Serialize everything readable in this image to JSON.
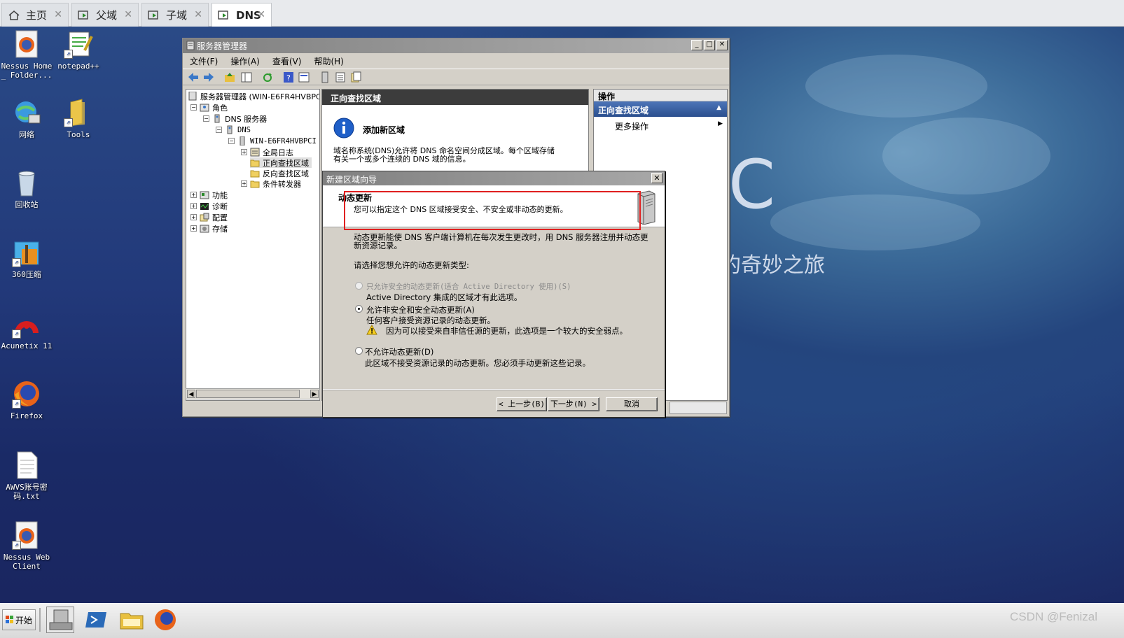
{
  "browser_tabs": [
    {
      "label": "主页",
      "icon": "home-icon"
    },
    {
      "label": "父域",
      "icon": "vm-icon"
    },
    {
      "label": "子域",
      "icon": "vm-icon"
    },
    {
      "label": "DNS",
      "icon": "vm-icon",
      "active": true
    }
  ],
  "desktop_icons": [
    {
      "label": "Nessus Home _ Folder...",
      "icon": "firefox-icon"
    },
    {
      "label": "notepad++",
      "icon": "notepad-plus-icon"
    },
    {
      "label": "网络",
      "icon": "network-icon"
    },
    {
      "label": "Tools",
      "icon": "folder-icon"
    },
    {
      "label": "回收站",
      "icon": "recycle-bin-icon"
    },
    {
      "label": "360压缩",
      "icon": "archive-icon"
    },
    {
      "label": "Acunetix 11",
      "icon": "acunetix-icon"
    },
    {
      "label": "Firefox",
      "icon": "firefox-icon"
    },
    {
      "label": "AWVS账号密码.txt",
      "icon": "text-file-icon"
    },
    {
      "label": "Nessus Web Client",
      "icon": "firefox-icon"
    }
  ],
  "wallpaper": {
    "big_letter": "C",
    "caption": "的奇妙之旅"
  },
  "server_manager": {
    "title": "服务器管理器",
    "menu": [
      "文件(F)",
      "操作(A)",
      "查看(V)",
      "帮助(H)"
    ],
    "tree": {
      "root": "服务器管理器 (WIN-E6FR4HVBPC",
      "roles": "角色",
      "dns_server": "DNS 服务器",
      "dns": "DNS",
      "host": "WIN-E6FR4HVBPCI",
      "global_log": "全局日志",
      "forward_zones": "正向查找区域",
      "reverse_zones": "反向查找区域",
      "forwarders": "条件转发器",
      "features": "功能",
      "diagnostics": "诊断",
      "configuration": "配置",
      "storage": "存储"
    },
    "middle": {
      "header": "正向查找区域",
      "add_zone_title": "添加新区域",
      "description_line1": "域名称系统(DNS)允许将 DNS 命名空间分成区域。每个区域存储",
      "description_line2": "有关一个或多个连续的 DNS 域的信息。"
    },
    "actions": {
      "header": "操作",
      "section": "正向查找区域",
      "more": "更多操作"
    }
  },
  "wizard": {
    "title": "新建区域向导",
    "heading": "动态更新",
    "subheading": "您可以指定这个 DNS 区域接受安全、不安全或非动态的更新。",
    "intro_line1": "动态更新能使 DNS 客户端计算机在每次发生更改时，用 DNS 服务器注册并动态更",
    "intro_line2": "新资源记录。",
    "prompt": "请选择您想允许的动态更新类型:",
    "option1_label": "只允许安全的动态更新(适合 Active Directory 使用)(S)",
    "option1_note": "Active Directory 集成的区域才有此选项。",
    "option2_label": "允许非安全和安全动态更新(A)",
    "option2_note": "任何客户接受资源记录的动态更新。",
    "option2_warning": "因为可以接受来自非信任源的更新，此选项是一个较大的安全弱点。",
    "option3_label": "不允许动态更新(D)",
    "option3_note": "此区域不接受资源记录的动态更新。您必须手动更新这些记录。",
    "selected_option": 2,
    "back_button": "< 上一步(B)",
    "next_button": "下一步(N) >",
    "cancel_button": "取消"
  },
  "taskbar": {
    "start_label": "开始"
  },
  "watermark": "CSDN @Fenizal"
}
